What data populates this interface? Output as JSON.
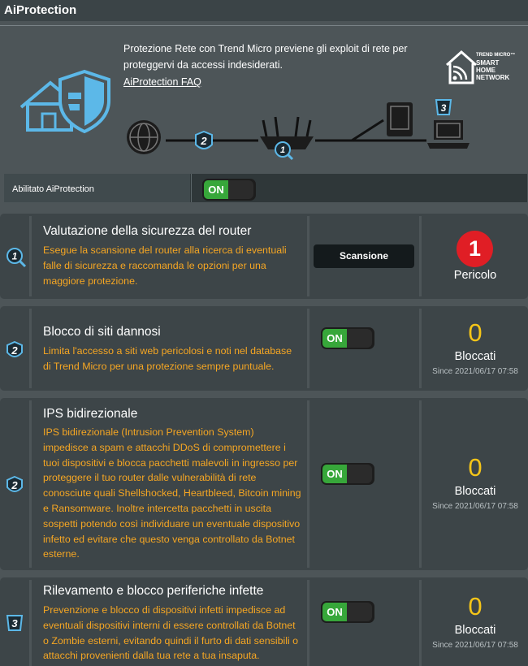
{
  "header": {
    "title": "AiProtection"
  },
  "intro": {
    "description": "Protezione Rete con Trend Micro previene gli exploit di rete per proteggervi da accessi indesiderati.",
    "faq_link": "AiProtection FAQ",
    "logo_line1": "TREND MICRO™",
    "logo_line2": "SMART",
    "logo_line3": "HOME",
    "logo_line4": "NETWORK"
  },
  "diagram": {
    "badge1": "1",
    "badge2": "2",
    "badge3": "3"
  },
  "enable": {
    "label": "Abilitato AiProtection",
    "toggle": "ON"
  },
  "colors": {
    "accent_orange": "#f5a623",
    "toggle_green": "#37a73a",
    "danger_red": "#e01e25",
    "count_yellow": "#f5c518"
  },
  "cards": [
    {
      "number": "1",
      "title": "Valutazione della sicurezza del router",
      "description": "Esegue la scansione del router alla ricerca di eventuali falle di sicurezza e raccomanda le opzioni per una maggiore protezione.",
      "button": "Scansione",
      "count": "1",
      "status": "Pericolo"
    },
    {
      "number": "2",
      "title": "Blocco di siti dannosi",
      "description": "Limita l'accesso a siti web pericolosi e noti nel database di Trend Micro per una protezione sempre puntuale.",
      "toggle": "ON",
      "count": "0",
      "status": "Bloccati",
      "since": "Since 2021/06/17 07:58"
    },
    {
      "number": "2",
      "title": "IPS bidirezionale",
      "description": "IPS bidirezionale (Intrusion Prevention System) impedisce a spam e attacchi DDoS di compromettere i tuoi dispositivi e blocca pacchetti malevoli in ingresso per proteggere il tuo router dalle vulnerabilità di rete conosciute quali Shellshocked, Heartbleed, Bitcoin mining e Ransomware. Inoltre intercetta pacchetti in uscita sospetti potendo così individuare un eventuale dispositivo infetto ed evitare che questo venga controllato da Botnet esterne.",
      "toggle": "ON",
      "count": "0",
      "status": "Bloccati",
      "since": "Since 2021/06/17 07:58"
    },
    {
      "number": "3",
      "title": "Rilevamento e blocco periferiche infette",
      "description": "Prevenzione e blocco di dispositivi infetti impedisce ad eventuali dispositivi interni di essere controllati da Botnet o Zombie esterni, evitando quindi il furto di dati sensibili o attacchi provenienti dalla tua rete a tua insaputa.",
      "toggle": "ON",
      "count": "0",
      "status": "Bloccati",
      "since": "Since 2021/06/17 07:58"
    }
  ]
}
